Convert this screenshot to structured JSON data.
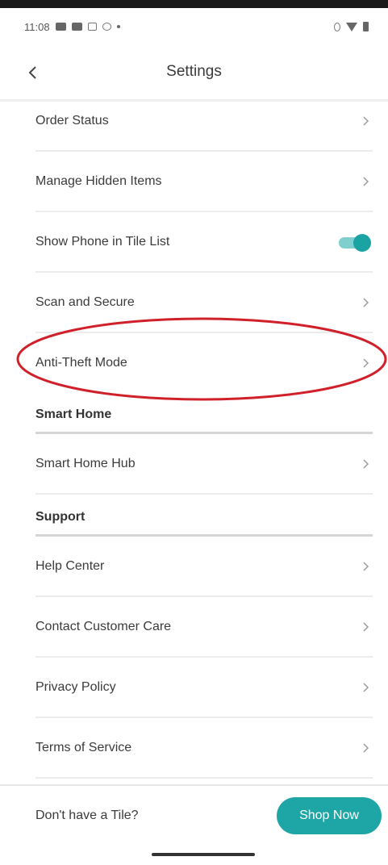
{
  "status_bar": {
    "time": "11:08"
  },
  "header": {
    "title": "Settings"
  },
  "rows_top": [
    {
      "label": "Order Status",
      "type": "chevron"
    },
    {
      "label": "Manage Hidden Items",
      "type": "chevron"
    },
    {
      "label": "Show Phone in Tile List",
      "type": "toggle",
      "toggle_on": true
    },
    {
      "label": "Scan and Secure",
      "type": "chevron"
    },
    {
      "label": "Anti-Theft Mode",
      "type": "chevron"
    }
  ],
  "smart_home": {
    "heading": "Smart Home",
    "items": [
      {
        "label": "Smart Home Hub"
      }
    ]
  },
  "support": {
    "heading": "Support",
    "items": [
      {
        "label": "Help Center"
      },
      {
        "label": "Contact Customer Care"
      },
      {
        "label": "Privacy Policy"
      },
      {
        "label": "Terms of Service"
      }
    ]
  },
  "bottom_bar": {
    "prompt": "Don't have a Tile?",
    "button_label": "Shop Now"
  },
  "colors": {
    "accent": "#1ea6a6",
    "highlight_ring": "#d0202a"
  }
}
